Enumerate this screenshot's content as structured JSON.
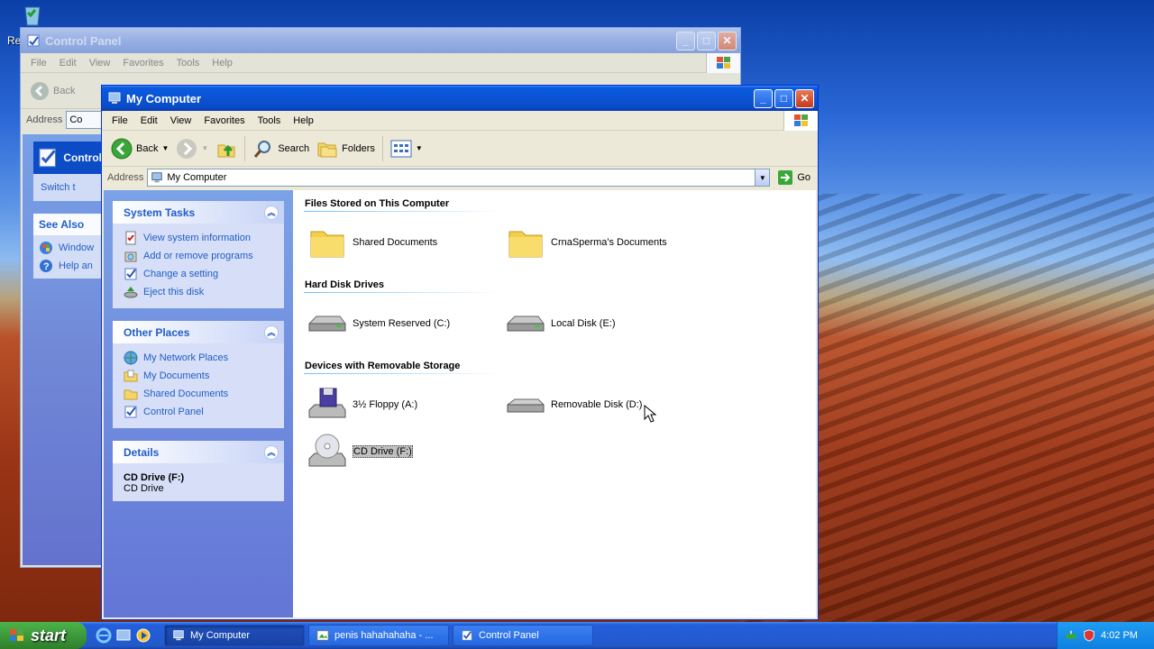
{
  "desktop": {
    "recycle_label": "Re"
  },
  "cp_window": {
    "title": "Control Panel",
    "menu": [
      "File",
      "Edit",
      "View",
      "Favorites",
      "Tools",
      "Help"
    ],
    "back_label": "Back",
    "address_label": "Address",
    "address_value": "Co",
    "header": "Control",
    "switch_text": "Switch t",
    "see_also": "See Also",
    "see_also_items": [
      "Window",
      "Help an"
    ]
  },
  "mc_window": {
    "title": "My Computer",
    "menu": [
      "File",
      "Edit",
      "View",
      "Favorites",
      "Tools",
      "Help"
    ],
    "toolbar": {
      "back": "Back",
      "search": "Search",
      "folders": "Folders"
    },
    "address": {
      "label": "Address",
      "value": "My Computer",
      "go": "Go"
    },
    "system_tasks": {
      "title": "System Tasks",
      "items": [
        "View system information",
        "Add or remove programs",
        "Change a setting",
        "Eject this disk"
      ]
    },
    "other_places": {
      "title": "Other Places",
      "items": [
        "My Network Places",
        "My Documents",
        "Shared Documents",
        "Control Panel"
      ]
    },
    "details": {
      "title": "Details",
      "name": "CD Drive (F:)",
      "type": "CD Drive"
    },
    "groups": {
      "files": {
        "title": "Files Stored on This Computer",
        "items": [
          "Shared Documents",
          "CrnaSperma's Documents"
        ]
      },
      "hdd": {
        "title": "Hard Disk Drives",
        "items": [
          "System Reserved (C:)",
          "Local Disk (E:)"
        ]
      },
      "removable": {
        "title": "Devices with Removable Storage",
        "items": [
          "3½ Floppy (A:)",
          "Removable Disk (D:)",
          "CD Drive (F:)"
        ]
      }
    }
  },
  "taskbar": {
    "start": "start",
    "tasks": [
      "My Computer",
      "penis hahahahaha - ...",
      "Control Panel"
    ],
    "clock": "4:02 PM"
  },
  "colors": {
    "xp_blue": "#0a55d6",
    "link_blue": "#215dc6",
    "start_green": "#3c9a3a"
  }
}
